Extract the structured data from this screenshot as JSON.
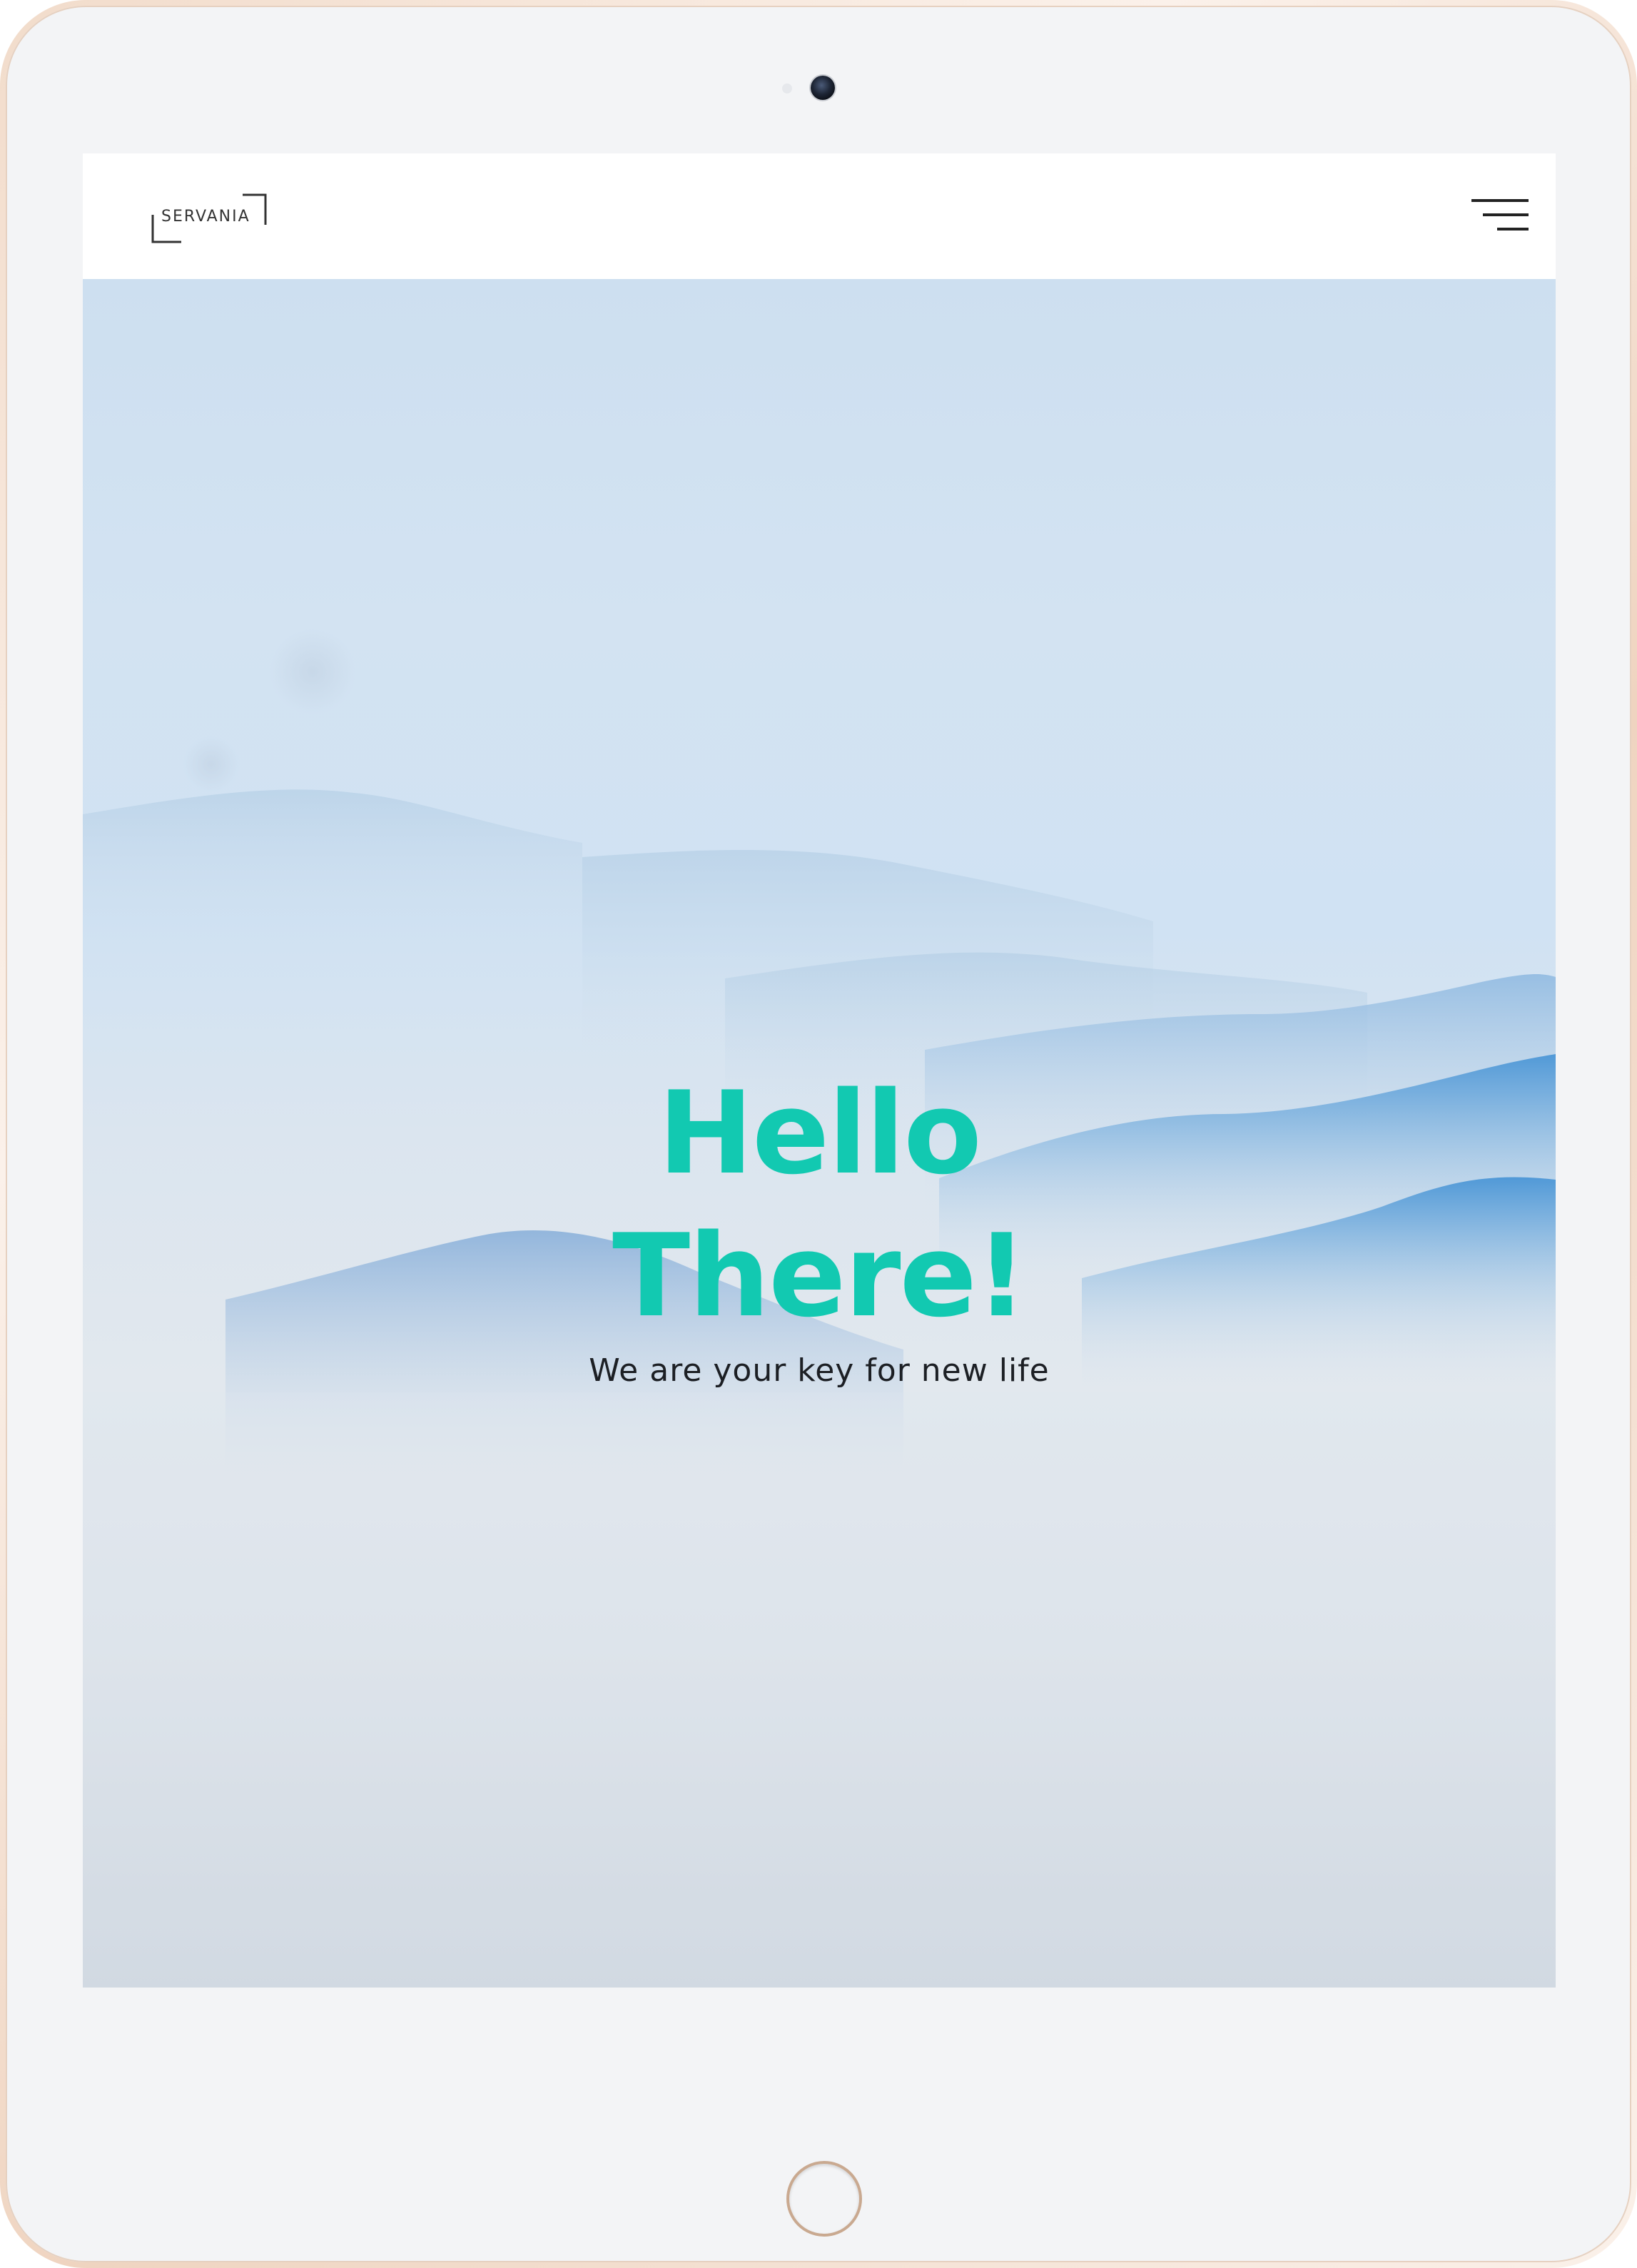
{
  "device": {
    "frame_color": "#f2dccb",
    "bezel_color": "#f3f4f6"
  },
  "navbar": {
    "logo_text": "SERVANIA",
    "menu_icon": "hamburger-menu-icon"
  },
  "hero": {
    "title_line1": "Hello",
    "title_line2": "There!",
    "subtitle": "We are your key for new life",
    "title_color": "#12c9b1",
    "subtitle_color": "#1c1f24"
  }
}
